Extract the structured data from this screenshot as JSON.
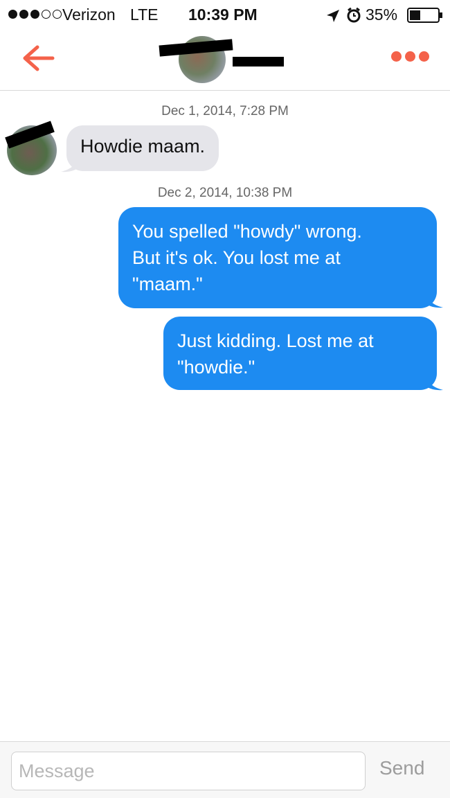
{
  "status_bar": {
    "carrier": "Verizon",
    "network": "LTE",
    "time": "10:39 PM",
    "battery": "35%",
    "signal_bars_filled": 3,
    "signal_bars_total": 5
  },
  "nav": {
    "back_icon": "arrow-left-icon",
    "more_icon": "more-dots-icon",
    "accent_color": "#f4624a"
  },
  "messages": [
    {
      "timestamp": "Dec 1, 2014, 7:28 PM"
    },
    {
      "direction": "received",
      "text": "Howdie maam."
    },
    {
      "timestamp": "Dec 2, 2014, 10:38 PM"
    },
    {
      "direction": "sent",
      "lines": [
        "You spelled \"howdy\" wrong.",
        "But it's ok. You lost me at",
        "\"maam.\""
      ]
    },
    {
      "direction": "sent",
      "lines": [
        "Just kidding. Lost me at",
        "\"howdie.\""
      ]
    }
  ],
  "composer": {
    "placeholder": "Message",
    "send_label": "Send"
  },
  "colors": {
    "sent_bubble": "#1d8bf1",
    "received_bubble": "#e5e5ea",
    "accent": "#f4624a"
  }
}
